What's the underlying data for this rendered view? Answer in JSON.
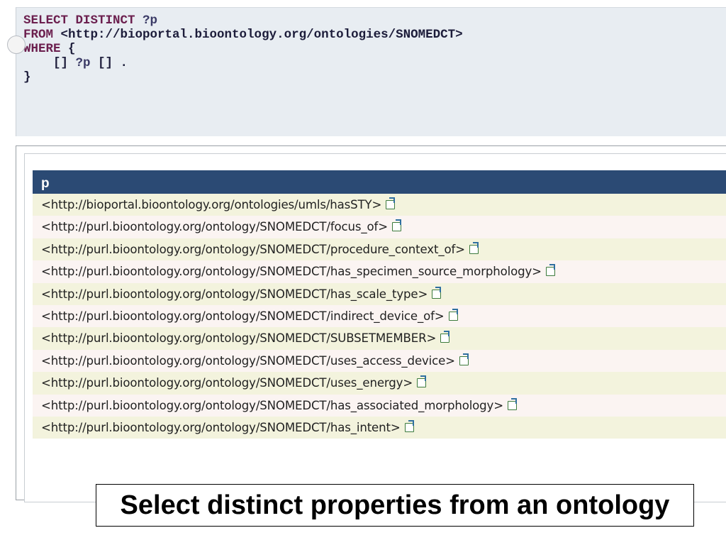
{
  "query": {
    "line1_kw": "SELECT DISTINCT",
    "line1_var": " ?p",
    "line2_kw": "FROM",
    "line2_rest": " <http://bioportal.bioontology.org/ontologies/SNOMEDCT>",
    "line3_kw": "WHERE",
    "line3_rest": " {",
    "line4_a": "    [] ",
    "line4_var": "?p",
    "line4_b": " [] .",
    "line5": "}"
  },
  "results": {
    "column_header": "p",
    "rows": [
      "<http://bioportal.bioontology.org/ontologies/umls/hasSTY>",
      "<http://purl.bioontology.org/ontology/SNOMEDCT/focus_of>",
      "<http://purl.bioontology.org/ontology/SNOMEDCT/procedure_context_of>",
      "<http://purl.bioontology.org/ontology/SNOMEDCT/has_specimen_source_morphology>",
      "<http://purl.bioontology.org/ontology/SNOMEDCT/has_scale_type>",
      "<http://purl.bioontology.org/ontology/SNOMEDCT/indirect_device_of>",
      "<http://purl.bioontology.org/ontology/SNOMEDCT/SUBSETMEMBER>",
      "<http://purl.bioontology.org/ontology/SNOMEDCT/uses_access_device>",
      "<http://purl.bioontology.org/ontology/SNOMEDCT/uses_energy>",
      "<http://purl.bioontology.org/ontology/SNOMEDCT/has_associated_morphology>",
      "<http://purl.bioontology.org/ontology/SNOMEDCT/has_intent>"
    ],
    "link_icon": "external-link-icon"
  },
  "caption": "Select distinct properties from an ontology"
}
